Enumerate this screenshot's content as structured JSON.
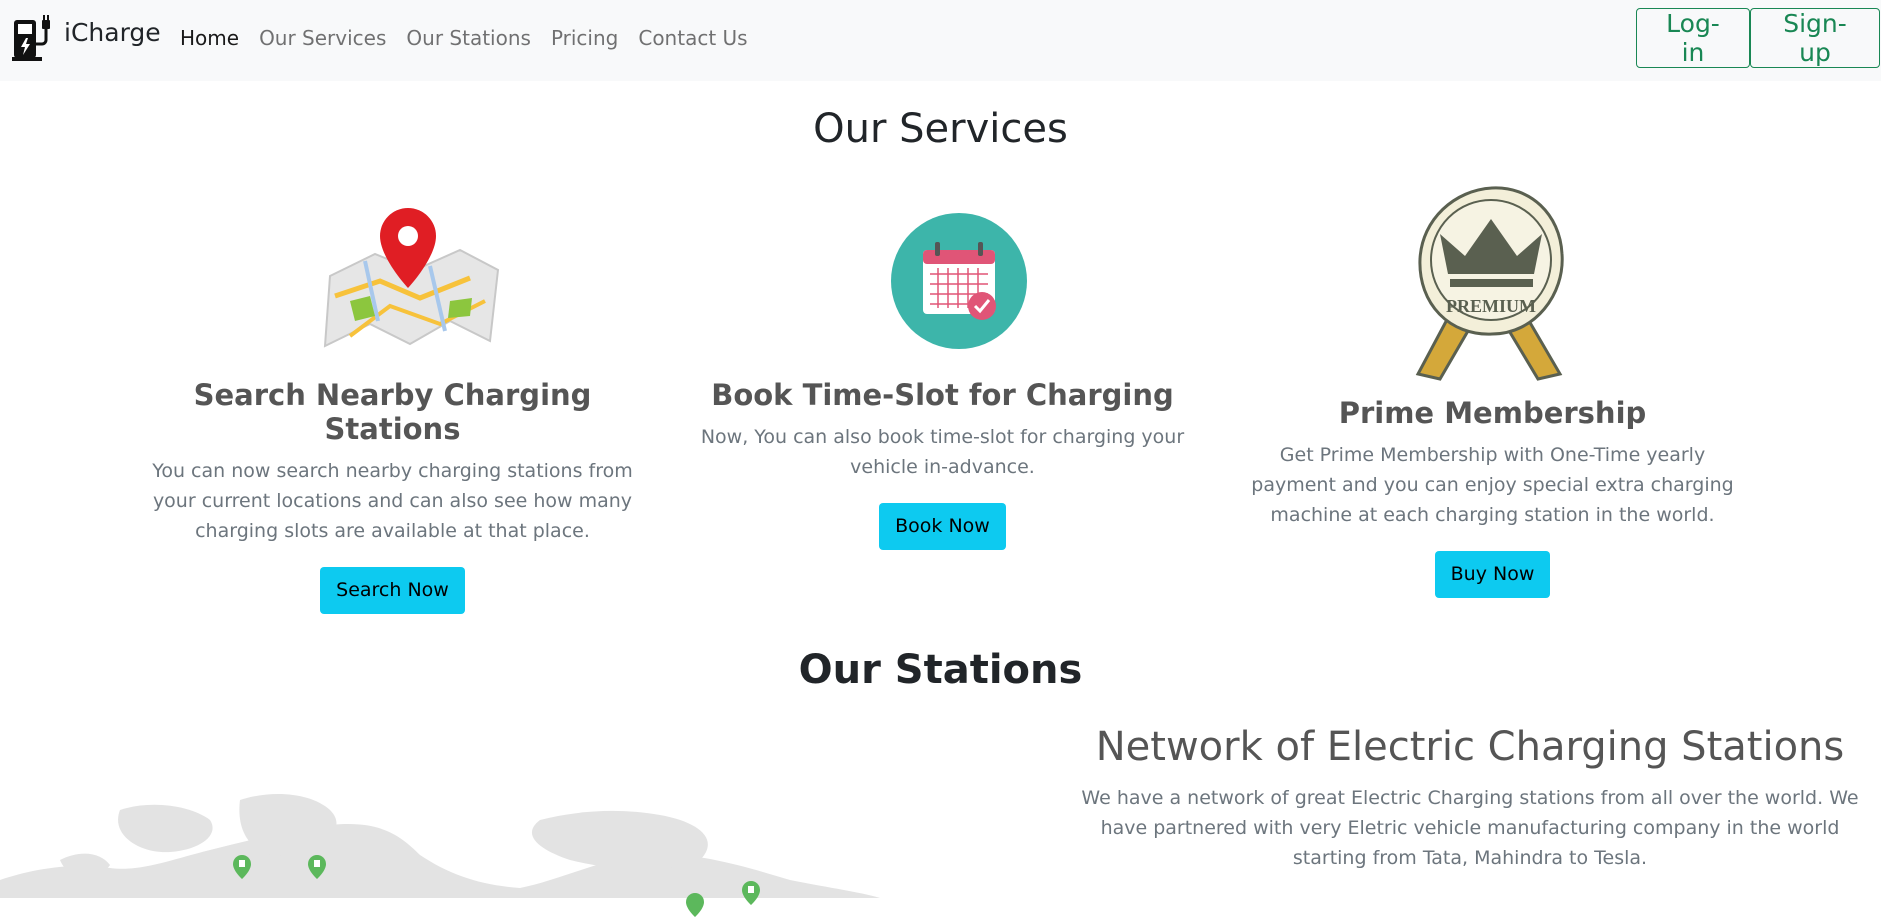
{
  "brand": {
    "name": "iCharge",
    "logo_icon": "ev-charger-icon"
  },
  "nav": {
    "links": [
      {
        "label": "Home",
        "active": true
      },
      {
        "label": "Our Services",
        "active": false
      },
      {
        "label": "Our Stations",
        "active": false
      },
      {
        "label": "Pricing",
        "active": false
      },
      {
        "label": "Contact Us",
        "active": false
      }
    ],
    "login_label": "Log-in",
    "signup_label": "Sign-up"
  },
  "services": {
    "title": "Our Services",
    "cards": [
      {
        "icon": "map-pin-icon",
        "title": "Search Nearby Charging Stations",
        "text": "You can now search nearby charging stations from your current locations and can also see how many charging slots are available at that place.",
        "button": "Search Now"
      },
      {
        "icon": "calendar-check-icon",
        "title": "Book Time-Slot for Charging",
        "text": "Now, You can also book time-slot for charging your vehicle in-advance.",
        "button": "Book Now"
      },
      {
        "icon": "premium-crown-badge-icon",
        "badge_text": "PREMIUM",
        "title": "Prime Membership",
        "text": "Get Prime Membership with One-Time yearly payment and you can enjoy special extra charging machine at each charging station in the world.",
        "button": "Buy Now"
      }
    ]
  },
  "stations": {
    "title": "Our Stations",
    "network_title": "Network of Electric Charging Stations",
    "network_text": "We have a network of great Electric Charging stations from all over the world. We have partnered with very Eletric vehicle manufacturing company in the world starting from Tata, Mahindra to Tesla.",
    "map_icon": "world-map-icon",
    "marker_icon": "charging-station-marker-icon"
  },
  "colors": {
    "navbar_bg": "#f8f9fa",
    "accent_green": "#198754",
    "button_info": "#0dcaf0",
    "heading_grey": "#555555",
    "text_grey": "#6c757d",
    "marker_green": "#5cb85c"
  }
}
